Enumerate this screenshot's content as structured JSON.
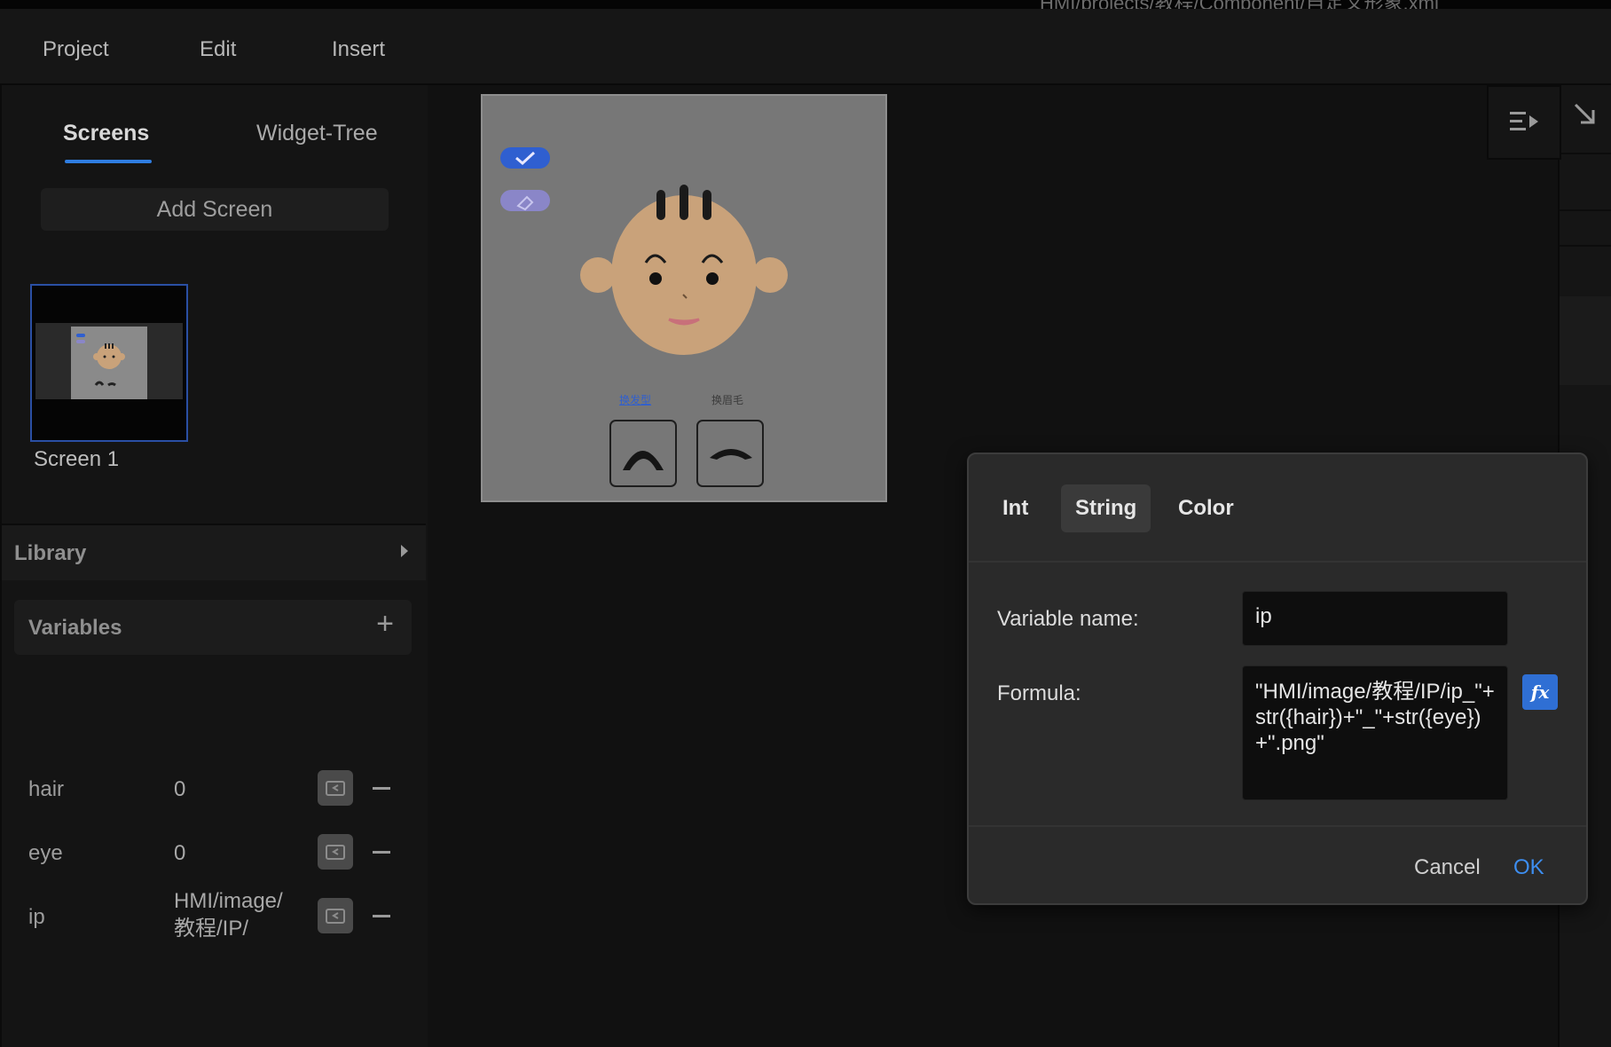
{
  "titlebar": {
    "path": "HMI/projects/教程/Component/自定义形象.xml"
  },
  "menu": {
    "items": [
      "Project",
      "Edit",
      "Insert"
    ]
  },
  "left_panel": {
    "tabs": [
      {
        "label": "Screens",
        "active": true
      },
      {
        "label": "Widget-Tree",
        "active": false
      }
    ],
    "add_screen_label": "Add Screen",
    "screens": [
      {
        "label": "Screen 1"
      }
    ],
    "library_label": "Library",
    "variables_label": "Variables",
    "variables": [
      {
        "name": "hair",
        "value": "0"
      },
      {
        "name": "eye",
        "value": "0"
      },
      {
        "name": "ip",
        "value": "HMI/image/\n教程/IP/"
      }
    ]
  },
  "artboard": {
    "labels": [
      "换发型",
      "换眉毛"
    ],
    "colors": {
      "accent": "#2f5fd0",
      "skin": "#c9a27a",
      "background": "#777777"
    }
  },
  "dialog": {
    "tabs": [
      {
        "label": "Int",
        "active": false
      },
      {
        "label": "String",
        "active": true
      },
      {
        "label": "Color",
        "active": false
      }
    ],
    "variable_name_label": "Variable name:",
    "variable_name_value": "ip",
    "formula_label": "Formula:",
    "formula_value": "\"HMI/image/教程/IP/ip_\"+str({hair})+\"_\"+str({eye})+\".png\"",
    "fx_label": "fx",
    "cancel_label": "Cancel",
    "ok_label": "OK"
  },
  "icons": [
    "panel-toggle-icon",
    "arrow-down-right-icon",
    "folder-link-icon",
    "minus-icon",
    "plus-icon",
    "checkmark-icon",
    "eraser-icon",
    "chevron-right-icon"
  ]
}
